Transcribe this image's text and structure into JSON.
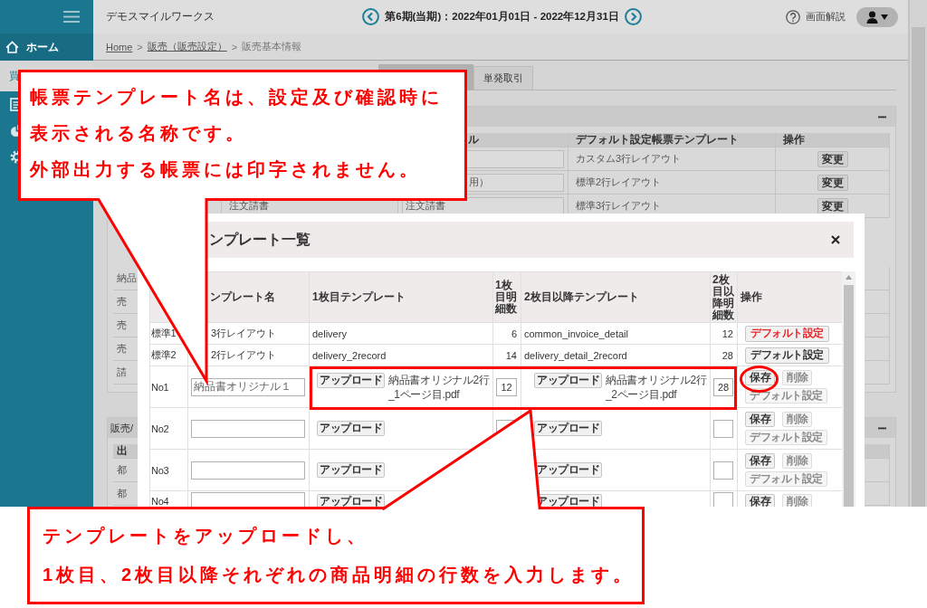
{
  "sidebar": {
    "items": [
      {
        "kind": "home",
        "label": "ホーム",
        "selected": false
      },
      {
        "kind": "plain",
        "label": "買",
        "selected": true
      }
    ]
  },
  "header": {
    "app_name": "デモスマイルワークス",
    "period": "第6期(当期)：2022年01月01日 - 2022年12月31日",
    "help_label": "画面解説"
  },
  "breadcrumb": {
    "separator": ">",
    "items": [
      {
        "label": "Home",
        "link": true
      },
      {
        "label": "販売（販売設定）",
        "link": true
      },
      {
        "label": "販売基本情報",
        "link": false
      }
    ]
  },
  "tabs": [
    {
      "selected": true
    },
    {
      "label": "単発取引",
      "selected": false
    }
  ],
  "sections": [
    {
      "table": {
        "header": {
          "title": "ル",
          "default_template": "デフォルト設定帳票テンプレート",
          "action": "操作"
        },
        "rows": [
          {
            "kind": "template",
            "default_template": "カスタム3行レイアウト",
            "action": "変更"
          },
          {
            "kind": "template",
            "title_value": "用）",
            "default_template": "標準2行レイアウト",
            "action": "変更"
          },
          {
            "kind": "template",
            "name": "注文請書",
            "title_value": "注文請書",
            "default_template": "標準3行レイアウト",
            "action": "変更"
          },
          {
            "kind": "label",
            "label": "納品"
          },
          {
            "kind": "label",
            "label": "売"
          },
          {
            "kind": "label",
            "label": "売"
          },
          {
            "kind": "label",
            "label": "売"
          },
          {
            "kind": "label",
            "label": "請"
          }
        ]
      }
    },
    {
      "title": "販売/",
      "table": {
        "header": {
          "label": "出"
        },
        "rows": [
          {
            "kind": "label",
            "label": "都"
          },
          {
            "kind": "label",
            "label": "都"
          }
        ]
      }
    }
  ],
  "modal": {
    "title": "ンプレート一覧",
    "columns": {
      "name": "ンプレート名",
      "first_template": "1枚目テンプレート",
      "first_rows": "1枚目明細数",
      "later_template": "2枚目以降テンプレート",
      "later_rows": "2枚目以降明細数",
      "actions": "操作"
    },
    "rows": [
      {
        "kind": "preset",
        "code": "標準1",
        "name": "3行レイアウト",
        "first_template": "delivery",
        "first_rows": "6",
        "later_template": "common_invoice_detail",
        "later_rows": "12",
        "button": {
          "label": "デフォルト設定",
          "active": true
        }
      },
      {
        "kind": "preset",
        "code": "標準2",
        "name": "2行レイアウト",
        "first_template": "delivery_2record",
        "first_rows": "14",
        "later_template": "delivery_detail_2record",
        "later_rows": "28",
        "button": {
          "label": "デフォルト設定",
          "active": false
        }
      },
      {
        "kind": "custom",
        "code": "No1",
        "name": "納品書オリジナル１",
        "first_upload": "アップロード",
        "first_file": "納品書オリジナル2行_1ページ目.pdf",
        "first_rows_field": true,
        "first_rows": "12",
        "later_upload": "アップロード",
        "later_file": "納品書オリジナル2行_2ページ目.pdf",
        "later_rows": "28",
        "buttons": [
          {
            "label": "保存",
            "disabled": false
          },
          {
            "label": "削除",
            "disabled": true
          },
          {
            "label": "デフォルト設定",
            "disabled": true
          }
        ]
      },
      {
        "kind": "custom",
        "code": "No2",
        "first_upload": "アップロード",
        "first_rows_field": true,
        "later_upload": "アップロード",
        "buttons": [
          {
            "label": "保存",
            "disabled": false
          },
          {
            "label": "削除",
            "disabled": true
          },
          {
            "label": "デフォルト設定",
            "disabled": true
          }
        ]
      },
      {
        "kind": "custom",
        "code": "No3",
        "first_upload": "アップロード",
        "first_rows_field": false,
        "later_upload": "アップロード",
        "buttons": [
          {
            "label": "保存",
            "disabled": false
          },
          {
            "label": "削除",
            "disabled": true
          },
          {
            "label": "デフォルト設定",
            "disabled": true
          }
        ]
      },
      {
        "kind": "custom",
        "code": "No4",
        "first_upload": "アップロード",
        "first_rows_field": false,
        "later_upload": "アップロード",
        "buttons": [
          {
            "label": "保存",
            "disabled": false
          },
          {
            "label": "削除",
            "disabled": true
          }
        ]
      }
    ]
  },
  "callouts": [
    {
      "lines": [
        "帳票テンプレート名は、設定及び確認時に",
        "表示される名称です。",
        "外部出力する帳票には印字されません。"
      ]
    },
    {
      "lines": [
        "テンプレートをアップロードし、",
        "1枚目、2枚目以降それぞれの商品明細の行数を入力します。"
      ]
    }
  ]
}
